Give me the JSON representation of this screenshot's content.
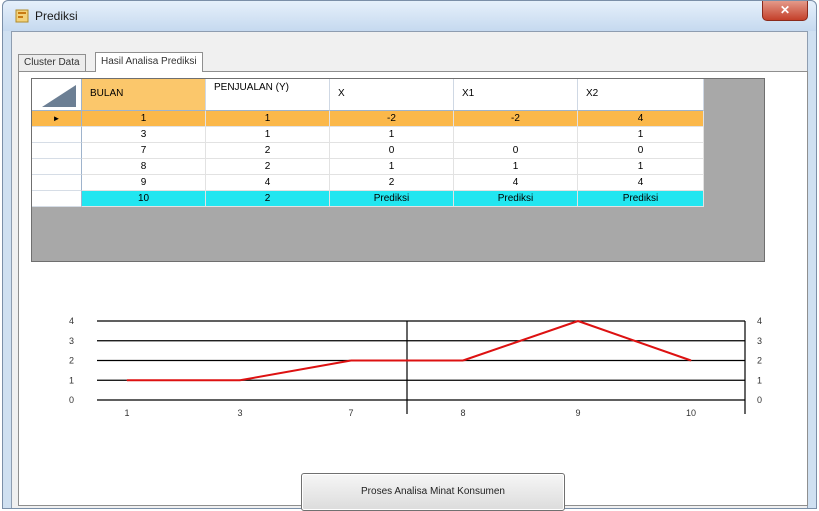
{
  "window": {
    "title": "Prediksi",
    "close_label": "✕",
    "icon": "app-icon"
  },
  "tabs": [
    {
      "label": "Cluster Data",
      "active": false
    },
    {
      "label": "Hasil Analisa Prediksi",
      "active": true
    }
  ],
  "grid": {
    "columns": [
      "BULAN",
      "PENJUALAN (Y)",
      "X",
      "X1",
      "X2"
    ],
    "row_marker": "►",
    "rows": [
      [
        "1",
        "1",
        "-2",
        "-2",
        "4"
      ],
      [
        "3",
        "1",
        "1",
        "",
        "1"
      ],
      [
        "7",
        "2",
        "0",
        "0",
        "0"
      ],
      [
        "8",
        "2",
        "1",
        "1",
        "1"
      ],
      [
        "9",
        "4",
        "2",
        "4",
        "4"
      ],
      [
        "10",
        "2",
        "Prediksi",
        "Prediksi",
        "Prediksi"
      ]
    ],
    "colors": {
      "selected_row": "#fbb84a",
      "header_selected": "#fbc76b",
      "prediction_row": "#22e6f0"
    }
  },
  "chart_data": {
    "type": "line",
    "categories": [
      "1",
      "3",
      "7",
      "8",
      "9",
      "10"
    ],
    "values": [
      1,
      1,
      2,
      2,
      4,
      2
    ],
    "ylim": [
      0,
      4
    ],
    "yticks": [
      "0",
      "1",
      "2",
      "3",
      "4"
    ],
    "grid": true,
    "line_color": "#dd1111"
  },
  "action_button": {
    "label": "Proses Analisa Minat Konsumen"
  }
}
